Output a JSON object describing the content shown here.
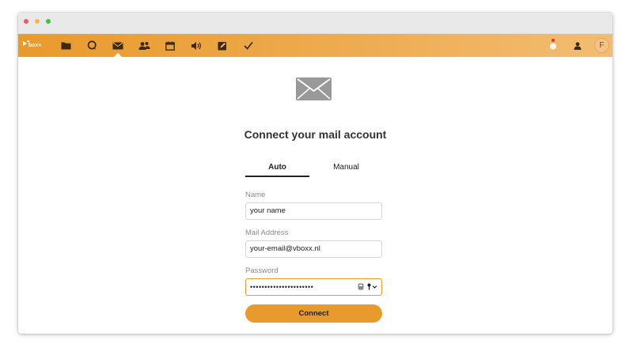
{
  "window": {
    "controls": [
      "close",
      "minimize",
      "maximize"
    ]
  },
  "navbar": {
    "logo_text": "boxx",
    "brand_color": "#e99a2c",
    "apps": [
      {
        "name": "files",
        "icon": "folder-icon"
      },
      {
        "name": "talk",
        "icon": "chat-bubble-icon"
      },
      {
        "name": "mail",
        "icon": "envelope-icon",
        "active": true
      },
      {
        "name": "contacts",
        "icon": "contacts-icon"
      },
      {
        "name": "calendar",
        "icon": "calendar-icon"
      },
      {
        "name": "audio",
        "icon": "speaker-icon"
      },
      {
        "name": "notes",
        "icon": "edit-icon"
      },
      {
        "name": "tasks",
        "icon": "checkmark-icon"
      }
    ],
    "right": {
      "notifications_icon": "notification-icon",
      "contacts_icon": "contacts-menu-icon",
      "avatar_letter": "F"
    }
  },
  "main": {
    "icon": "envelope-icon",
    "heading": "Connect your mail account",
    "tabs": [
      {
        "label": "Auto",
        "active": true
      },
      {
        "label": "Manual",
        "active": false
      }
    ],
    "form": {
      "name_label": "Name",
      "name_value": "your name",
      "email_label": "Mail Address",
      "email_value": "your-email@vboxx.nl",
      "password_label": "Password",
      "password_masked": "••••••••••••••••••••••",
      "connect_label": "Connect"
    }
  }
}
